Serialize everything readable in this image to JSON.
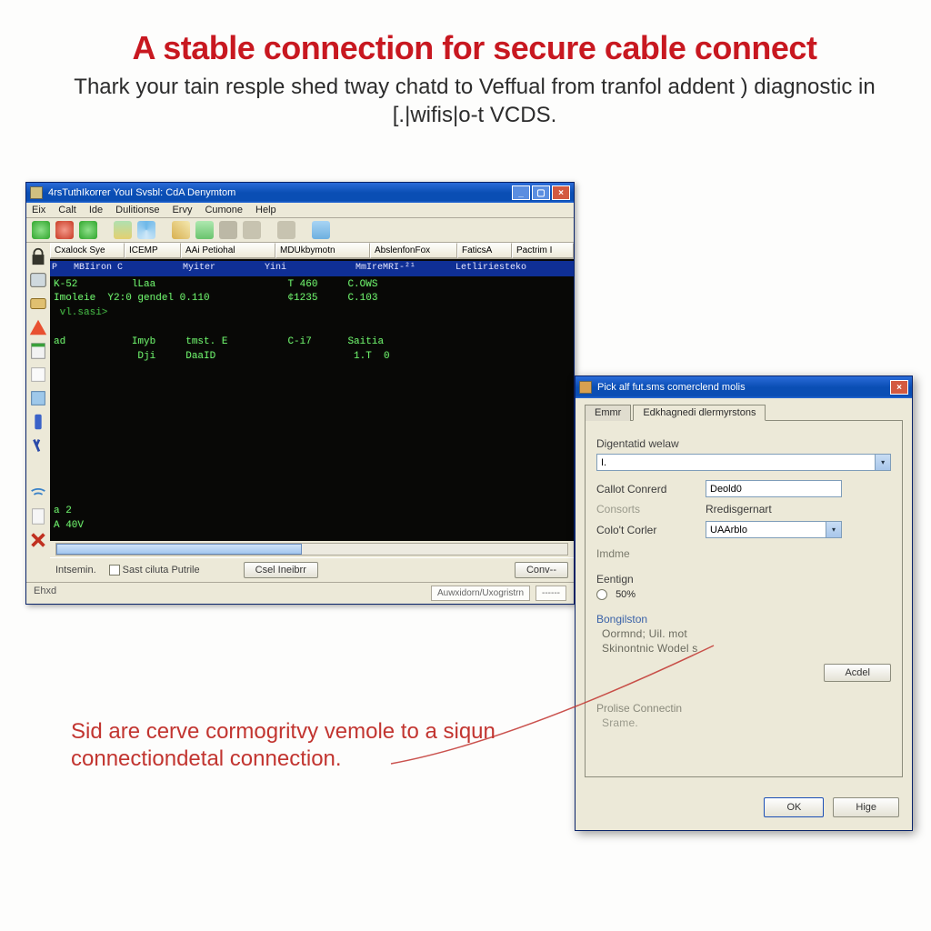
{
  "headline": {
    "title": "A stable connection for secure cable connect",
    "subtitle": "Thark your tain resple shed tway chatd to Veffual from tranfol addent ) diagnostic in [.|wifis|o-t VCDS."
  },
  "main_window": {
    "title": "4rsTuthIkorrer YouI Svsbl: CdA Denymtom",
    "menus": [
      "Eix",
      "Calt",
      "Ide",
      "Dulitionse",
      "Ervy",
      "Cumone",
      "Help"
    ],
    "column_headers": [
      "Cxalock Sye",
      "ICEMP",
      "AAi Petiohal",
      "MDUkbymotn",
      "AbslenfonFox",
      "FaticsA",
      "Pactrim I"
    ],
    "terminal_header": {
      "c0": "P",
      "c1": "MBIiron C",
      "c2": "   Myiter",
      "c3": "Yini",
      "c4": "MmIreMRI-²¹",
      "c5": "Letliriesteko"
    },
    "terminal_rows": [
      "K-52         lLaa                      T 460     C.OWS",
      "Imoleie  Y2:0 gendel 0.110             ¢1235     C.103",
      " vl.sasi>",
      " ",
      "ad           Imyb     tmst. E          C-i7      Saitia",
      "              Dji     DaaID                       1.T  0"
    ],
    "terminal_bottom": [
      "a 2",
      "A 40V"
    ],
    "status": {
      "intsemin_label": "Intsemin.",
      "sort_checkbox_label": "Sast ciluta Putrile",
      "button_csel": "Csel Ineibrr",
      "button_conv": "Conv--",
      "bottom_left": "Ehxd",
      "bottom_right_1": "Auwxidorn/Uxogristrn",
      "bottom_right_2": "------"
    },
    "toolbar_icons": [
      "back-icon",
      "stop-icon",
      "forward-icon",
      "sep",
      "shuffle-icon",
      "refresh-icon",
      "sep",
      "pencil-icon",
      "wand-icon",
      "camera-icon",
      "code-icon",
      "sep",
      "window-icon",
      "sep",
      "note-icon"
    ],
    "sidebar_icons": [
      "lock-icon",
      "list-icon",
      "card-icon",
      "warn-icon",
      "spreadsheet-icon",
      "box-icon",
      "chart-icon",
      "phone-icon",
      "lambda-icon",
      "blank-icon",
      "wifi-icon",
      "doc-icon",
      "x-icon",
      "blank2-icon"
    ]
  },
  "dialog": {
    "title": "Pick alf fut.sms comerclend molis",
    "tabs": [
      "Emmr",
      "Edkhagnedi dlermyrstons"
    ],
    "diag_label": "Digentatid welaw",
    "diag_value": "I.",
    "callot_label": "Callot Conrerd",
    "callot_value": "Deold0",
    "consort_label": "Consorts",
    "redesign_label": "Rredisgernart",
    "color_label": "Colo't Corler",
    "color_value": "UAArblo",
    "index_label": "Imdme",
    "entry_label": "Eentign",
    "entry_radio": "50%",
    "bongl_label": "Bongilston",
    "bongl_line1": "Oormnd; Uil. mot",
    "bongl_line2": "Skinontnic Wodel s",
    "acdel_button": "Acdel",
    "prolise_label": "Prolise Connectin",
    "prolise_sub": "Srame.",
    "ok_button": "OK",
    "help_button": "Hige"
  },
  "annotation": "Sid are cerve cormogritvy vemole to a siqun connectiondetal connection."
}
